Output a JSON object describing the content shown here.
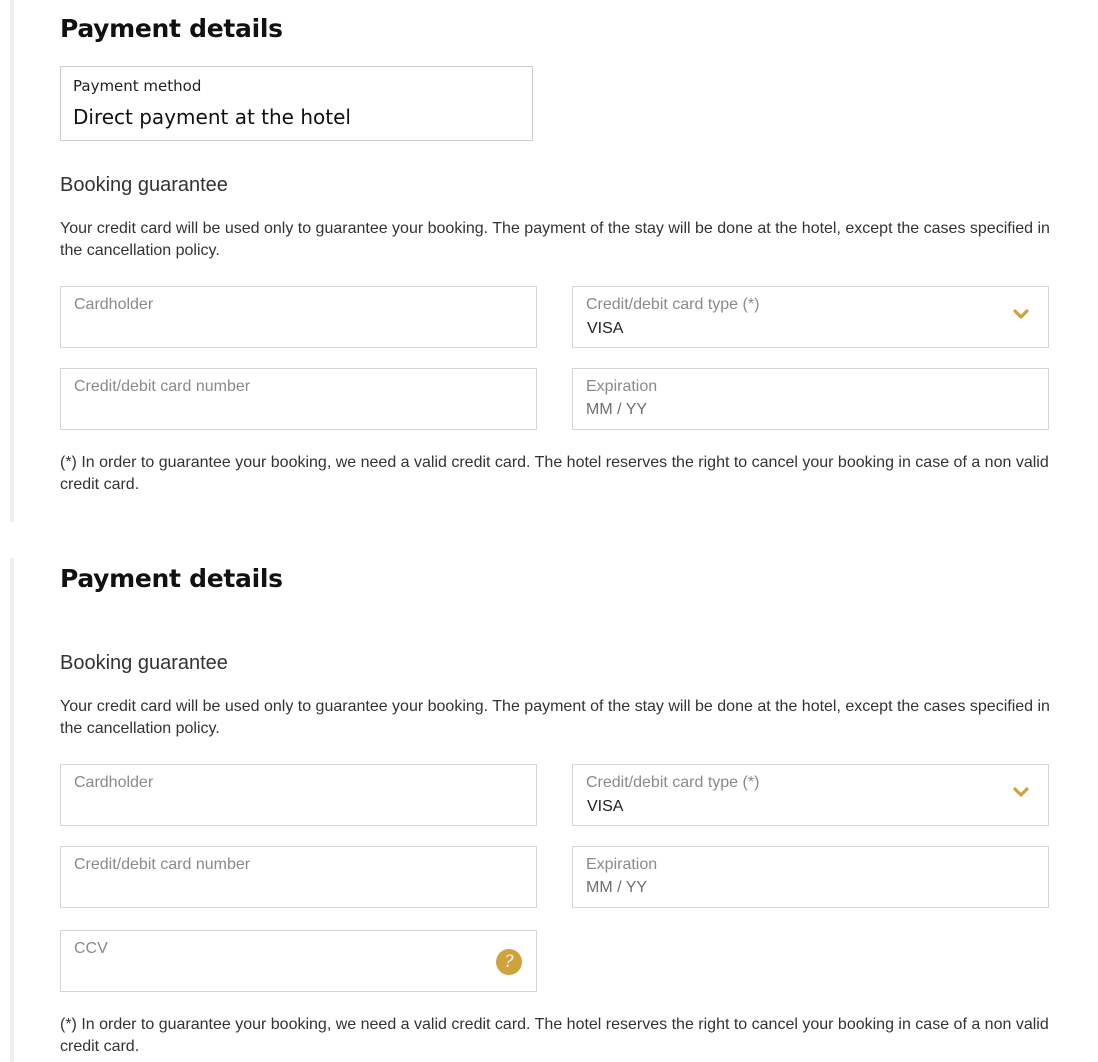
{
  "colors": {
    "accent": "#d1a13d",
    "border": "#d6d6d6",
    "sidebar_rule": "#efefef"
  },
  "icons": {
    "dropdown": "chevron-down-icon",
    "help": "question-mark-icon"
  },
  "section1": {
    "title": "Payment details",
    "payment_method": {
      "label": "Payment method",
      "value": "Direct payment at the hotel"
    },
    "booking_guarantee": {
      "heading": "Booking guarantee",
      "description": "Your credit card will be used only to guarantee your booking. The payment of the stay will be done at the hotel, except the cases specified in the cancellation policy.",
      "fields": {
        "cardholder": {
          "label": "Cardholder"
        },
        "card_type": {
          "label": "Credit/debit card type (*)",
          "value": "VISA"
        },
        "card_number": {
          "label": "Credit/debit card number"
        },
        "expiration": {
          "label": "Expiration",
          "placeholder": "MM / YY"
        }
      },
      "note": "(*) In order to guarantee your booking, we need a valid credit card. The hotel reserves the right to cancel your booking in case of a non valid credit card."
    }
  },
  "section2": {
    "title": "Payment details",
    "booking_guarantee": {
      "heading": "Booking guarantee",
      "description": "Your credit card will be used only to guarantee your booking. The payment of the stay will be done at the hotel, except the cases specified in the cancellation policy.",
      "fields": {
        "cardholder": {
          "label": "Cardholder"
        },
        "card_type": {
          "label": "Credit/debit card type (*)",
          "value": "VISA"
        },
        "card_number": {
          "label": "Credit/debit card number"
        },
        "expiration": {
          "label": "Expiration",
          "placeholder": "MM / YY"
        },
        "ccv": {
          "label": "CCV",
          "help_glyph": "?"
        }
      },
      "note": "(*) In order to guarantee your booking, we need a valid credit card. The hotel reserves the right to cancel your booking in case of a non valid credit card."
    }
  }
}
